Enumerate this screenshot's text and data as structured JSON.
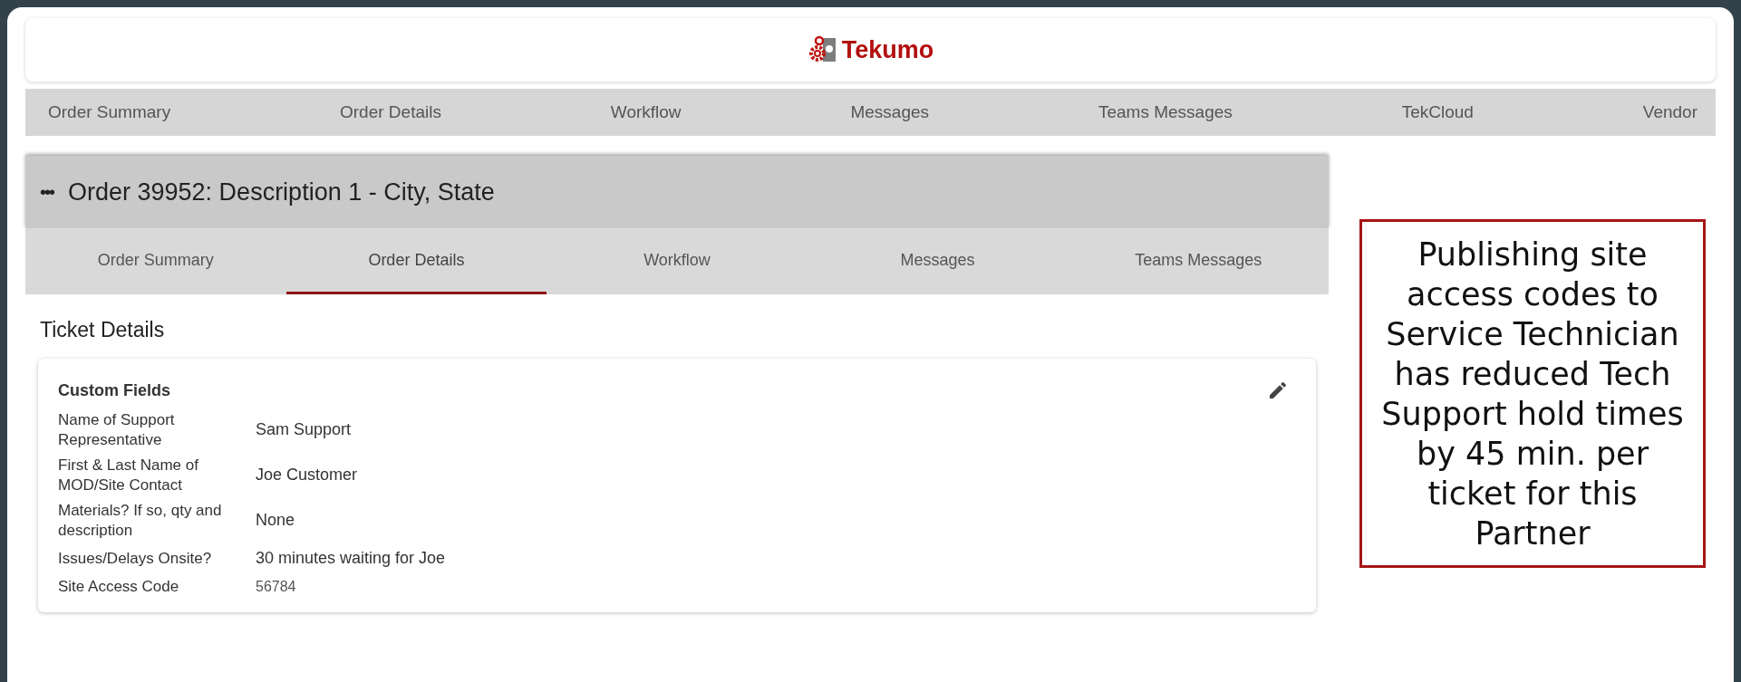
{
  "brand": {
    "name": "Tekumo"
  },
  "top_nav": [
    {
      "label": "Order Summary"
    },
    {
      "label": "Order Details"
    },
    {
      "label": "Workflow"
    },
    {
      "label": "Messages"
    },
    {
      "label": "Teams Messages"
    },
    {
      "label": "TekCloud"
    },
    {
      "label": "Vendor"
    }
  ],
  "order": {
    "menu": "•••",
    "title": "Order 39952: Description 1 - City, State",
    "tabs": [
      {
        "label": "Order Summary",
        "selected": false
      },
      {
        "label": "Order Details",
        "selected": true
      },
      {
        "label": "Workflow",
        "selected": false
      },
      {
        "label": "Messages",
        "selected": false
      },
      {
        "label": "Teams Messages",
        "selected": false
      }
    ]
  },
  "section_title": "Ticket Details",
  "card": {
    "title": "Custom Fields",
    "fields": [
      {
        "label": "Name of Support Representative",
        "value": "Sam Support",
        "kind": "text"
      },
      {
        "label": "First & Last Name of MOD/Site Contact",
        "value": "Joe Customer",
        "kind": "text"
      },
      {
        "label": "Materials? If so, qty and description",
        "value": "None",
        "kind": "text"
      },
      {
        "label": "Issues/Delays Onsite?",
        "value": "30 minutes waiting for Joe",
        "kind": "text"
      },
      {
        "label": "Site Access Code",
        "value": "56784",
        "kind": "code"
      }
    ]
  },
  "callout": {
    "text": "Publishing site access codes to Service Technician has reduced Tech Support hold times by 45 min. per ticket for this Partner"
  }
}
